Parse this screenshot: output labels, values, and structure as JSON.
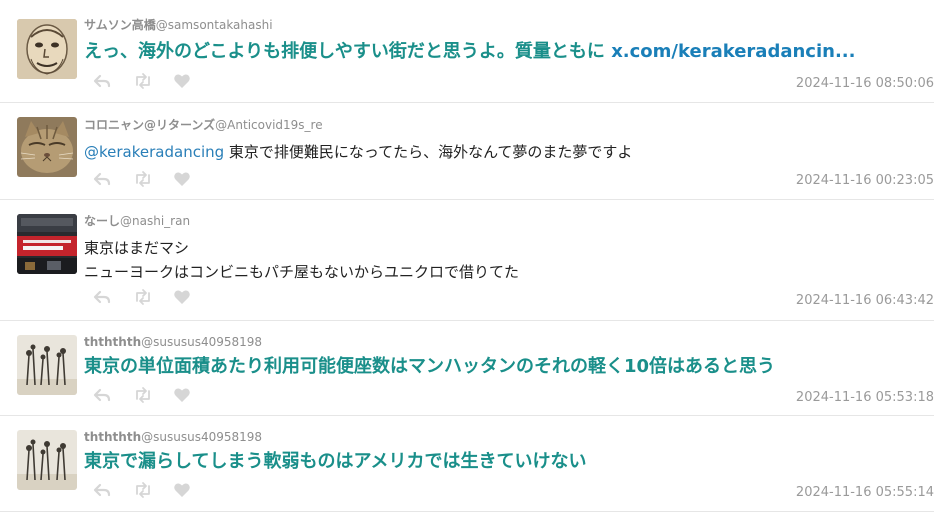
{
  "tweets": [
    {
      "display_name": "サムソン高橋",
      "handle": "@samsontakahashi",
      "text": "えっ、海外のどこよりも排便しやすい街だと思うよ。質量ともに ",
      "link": "x.com/kerakeradancin...",
      "timestamp": "2024-11-16 08:50:06"
    },
    {
      "display_name": "コロニャン@リターンズ",
      "handle": "@Anticovid19s_re",
      "mention": "@kerakeradancing",
      "text": " 東京で排便難民になってたら、海外なんて夢のまた夢ですよ",
      "timestamp": "2024-11-16 00:23:05"
    },
    {
      "display_name": "なーし",
      "handle": "@nashi_ran",
      "text_line1": "東京はまだマシ",
      "text_line2": "ニューヨークはコンビニもパチ屋もないからユニクロで借りてた",
      "timestamp": "2024-11-16 06:43:42"
    },
    {
      "display_name": "thththth",
      "handle": "@sususus40958198",
      "text": "東京の単位面積あたり利用可能便座数はマンハッタンのそれの軽く10倍はあると思う",
      "timestamp": "2024-11-16 05:53:18"
    },
    {
      "display_name": "thththth",
      "handle": "@sususus40958198",
      "text": "東京で漏らしてしまう軟弱ものはアメリカでは生きていけない",
      "timestamp": "2024-11-16 05:55:14"
    }
  ],
  "icons": {
    "reply": "reply-icon",
    "retweet": "retweet-icon",
    "like": "heart-icon"
  },
  "colors": {
    "emphasis_text": "#1a8f8a",
    "mention": "#2a7fb8",
    "meta_gray": "#8e8e8e",
    "action_gray": "#d6d6d6"
  }
}
